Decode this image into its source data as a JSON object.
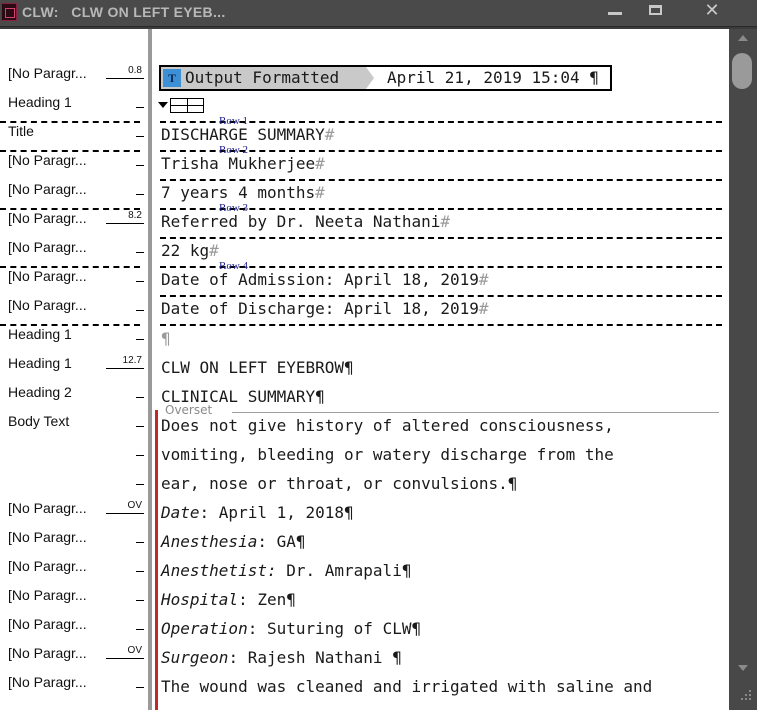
{
  "window": {
    "title": "CLW:   CLW ON LEFT EYEB...",
    "minimize_glyph": "",
    "close_glyph": "✕"
  },
  "style_rows": [
    {
      "label": "[No Paragr...",
      "depth": "0.8"
    },
    {
      "label": "Heading 1",
      "depth": ""
    },
    {
      "label": "Title",
      "depth": ""
    },
    {
      "label": "[No Paragr...",
      "depth": ""
    },
    {
      "label": "[No Paragr...",
      "depth": ""
    },
    {
      "label": "[No Paragr...",
      "depth": "8.2"
    },
    {
      "label": "[No Paragr...",
      "depth": ""
    },
    {
      "label": "[No Paragr...",
      "depth": ""
    },
    {
      "label": "[No Paragr...",
      "depth": ""
    },
    {
      "label": "Heading 1",
      "depth": ""
    },
    {
      "label": "Heading 1",
      "depth": "12.7"
    },
    {
      "label": "Heading 2",
      "depth": ""
    },
    {
      "label": "Body Text",
      "depth": ""
    },
    {
      "label": "",
      "depth": ""
    },
    {
      "label": "",
      "depth": ""
    },
    {
      "label": "[No Paragr...",
      "depth": "OV"
    },
    {
      "label": "[No Paragr...",
      "depth": ""
    },
    {
      "label": "[No Paragr...",
      "depth": ""
    },
    {
      "label": "[No Paragr...",
      "depth": ""
    },
    {
      "label": "[No Paragr...",
      "depth": ""
    },
    {
      "label": "[No Paragr...",
      "depth": "OV"
    },
    {
      "label": "[No Paragr...",
      "depth": ""
    }
  ],
  "output_tag": {
    "icon_text": "T",
    "label": "Output Formatted",
    "date_text": "April 21, 2019 15:04 ¶"
  },
  "table_rows": {
    "row1": "Row 1",
    "row2": "Row 2",
    "row3": "Row 3",
    "row4": "Row 4"
  },
  "story_lines": {
    "discharge": "DISCHARGE SUMMARY",
    "patient": "Trisha Mukherjee",
    "age": "7 years 4 months",
    "referred": "Referred by Dr. Neeta Nathani",
    "weight": "22 kg",
    "admission": "Date of Admission: April 18, 2019",
    "discharge_date": "Date of Discharge: April 18, 2019",
    "blank": "¶",
    "heading": "CLW ON LEFT EYEBROW¶",
    "clinical": "CLINICAL SUMMARY¶",
    "body1": "Does not give history of altered consciousness, ",
    "body2": "vomiting, bleeding or watery discharge from the ",
    "body3": "ear, nose or throat, or convulsions.¶",
    "date_label": "Date",
    "date_value": ": April 1, 2018¶",
    "anesthesia_label": "Anesthesia",
    "anesthesia_value": ": GA¶",
    "anesthetist_label": "Anesthetist:",
    "anesthetist_value": " Dr. Amrapali¶",
    "hospital_label": "Hospital",
    "hospital_value": ": Zen¶",
    "operation_label": "Operation",
    "operation_value": ": Suturing of CLW¶",
    "surgeon_label": "Surgeon",
    "surgeon_value": ": Rajesh Nathani ¶",
    "last": "The wound was cleaned and irrigated with saline and "
  },
  "cell_end_mark": "#",
  "overset_label": "Overset"
}
